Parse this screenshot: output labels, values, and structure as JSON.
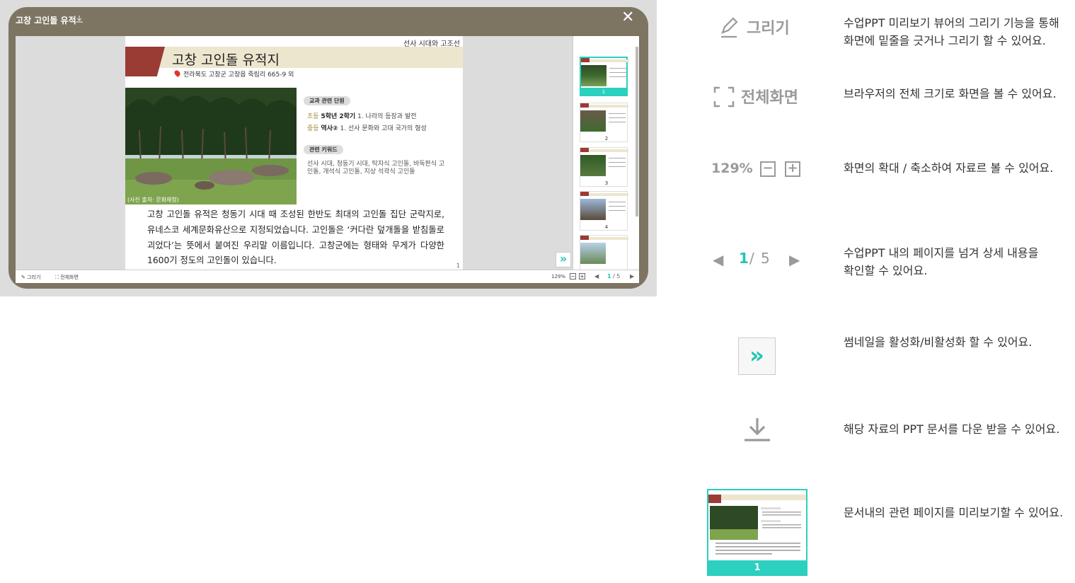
{
  "viewer": {
    "title": "고창 고인돌 유적",
    "close_label": "✕",
    "slide": {
      "breadcrumb": "선사 시대와 고조선",
      "title": "고창 고인돌 유적지",
      "address": "전라북도 고창군 고창읍 죽림리 665-9 외",
      "photo_caption": "(사진 출처: 문화재청)",
      "pill_curriculum": "교과 관련 단원",
      "curr1_level": "초등",
      "curr1_grade": "5학년 2학기",
      "curr1_unit": "1. 나라의 등장과 발전",
      "curr2_level": "중등",
      "curr2_subject": "역사②",
      "curr2_unit": "1. 선사 문화와 고대 국가의 형성",
      "pill_keywords": "관련 키워드",
      "keywords": "선사 시대, 청동기 시대, 탁자식 고인돌, 바둑판식 고인돌, 개석식 고인돌, 지상 석곽식 고인돌",
      "body": "고창 고인돌 유적은 청동기 시대 때 조성된 한반도 최대의 고인돌 집단 군락지로, 유네스코 세계문화유산으로 지정되었습니다. 고인돌은 ‘커다란 덮개돌을 받침돌로 괴었다’는 뜻에서 붙여진 우리말 이름입니다. 고창군에는 형태와 무게가 다양한 1600기 정도의 고인돌이 있습니다.",
      "page_number": "1"
    },
    "thumbs": [
      "1",
      "2",
      "3",
      "4"
    ],
    "toggle_label": "»",
    "toolbar": {
      "draw": "그리기",
      "fullscreen": "전체화면",
      "zoom": "129%",
      "minus": "−",
      "plus": "+",
      "prev": "◀",
      "current": "1",
      "total": "/ 5",
      "next": "▶"
    }
  },
  "legend": {
    "draw_label": "그리기",
    "draw_desc": "수업PPT 미리보기 뷰어의 그리기 기능을 통해\n화면에 밑줄을 긋거나 그리기 할 수 있어요.",
    "full_label": "전체화면",
    "full_desc": "브라우저의 전체 크기로 화면을 볼 수 있어요.",
    "zoom_value": "129%",
    "zoom_minus": "−",
    "zoom_plus": "+",
    "zoom_desc": "화면의 확대 / 축소하여 자료르 볼 수 있어요.",
    "page_current": "1",
    "page_slash": "/",
    "page_total": "5",
    "page_prev": "◀",
    "page_next": "▶",
    "page_desc": "수업PPT 내의 페이지를 넘겨 상세 내용을\n확인할 수 있어요.",
    "toggle_label": "»",
    "toggle_desc": "썸네일을 활성화/비활성화 할 수 있어요.",
    "download_desc": "해당 자료의 PPT 문서를 다운 받을 수 있어요.",
    "thumb_num": "1",
    "thumb_desc": "문서내의 관련 페이지를 미리보기할 수 있어요."
  },
  "colors": {
    "accent": "#2bd0bf",
    "frame": "#7d7462",
    "slide_red": "#9a3b34"
  }
}
